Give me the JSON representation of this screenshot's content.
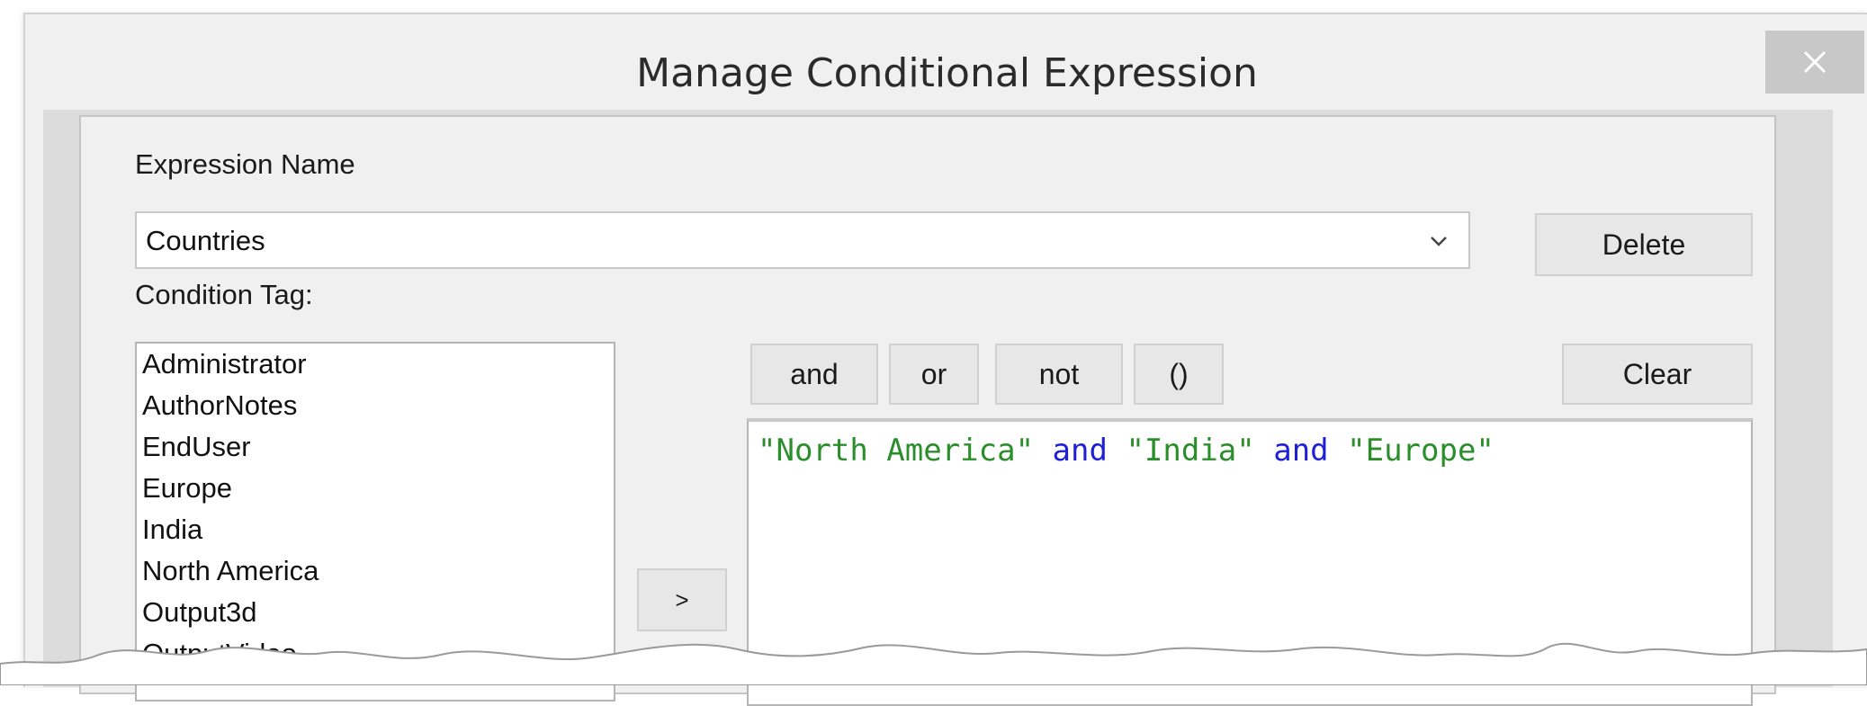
{
  "window": {
    "title": "Manage Conditional Expression",
    "close_icon": "close-icon"
  },
  "form": {
    "expression_name_label": "Expression Name",
    "expression_name_value": "Countries",
    "dropdown_icon": "chevron-down-icon",
    "delete_label": "Delete",
    "condition_tag_label": "Condition Tag:",
    "condition_tags": [
      "Administrator",
      "AuthorNotes",
      "EndUser",
      "Europe",
      "India",
      "North America",
      "Output3d",
      "OutputVideo"
    ],
    "add_button_label": ">",
    "operators": {
      "and": "and",
      "or": "or",
      "not": "not",
      "parens": "()"
    },
    "clear_label": "Clear",
    "expression_tokens": [
      {
        "text": "\"North America\"",
        "kind": "string"
      },
      {
        "text": " ",
        "kind": "space"
      },
      {
        "text": "and",
        "kind": "keyword"
      },
      {
        "text": " ",
        "kind": "space"
      },
      {
        "text": "\"India\"",
        "kind": "string"
      },
      {
        "text": " ",
        "kind": "space"
      },
      {
        "text": "and",
        "kind": "keyword"
      },
      {
        "text": " ",
        "kind": "space"
      },
      {
        "text": "\"Europe\"",
        "kind": "string"
      }
    ]
  },
  "colors": {
    "string": "#2a8f2a",
    "keyword": "#1f1fd6",
    "dialog_bg": "#f0f0f0",
    "close_bg": "#c8c8c8"
  }
}
